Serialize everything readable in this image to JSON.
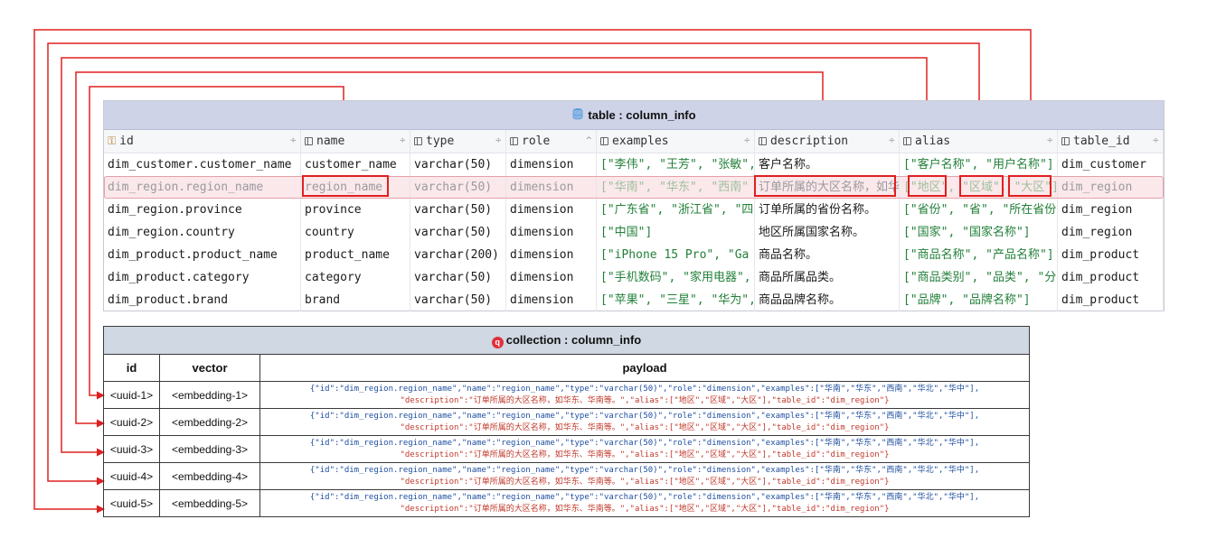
{
  "table": {
    "title": "table : column_info",
    "columns": [
      {
        "name": "id",
        "icon": "key-icon",
        "sort": "÷"
      },
      {
        "name": "name",
        "icon": "column-icon",
        "sort": "÷"
      },
      {
        "name": "type",
        "icon": "column-icon",
        "sort": "÷"
      },
      {
        "name": "role",
        "icon": "column-icon",
        "sort": "^"
      },
      {
        "name": "examples",
        "icon": "column-icon",
        "sort": "÷"
      },
      {
        "name": "description",
        "icon": "column-icon",
        "sort": "÷"
      },
      {
        "name": "alias",
        "icon": "column-icon",
        "sort": "÷"
      },
      {
        "name": "table_id",
        "icon": "column-icon",
        "sort": "÷"
      }
    ],
    "rows": [
      {
        "id": "dim_customer.customer_name",
        "name": "customer_name",
        "type": "varchar(50)",
        "role": "dimension",
        "examples": "[\"李伟\", \"王芳\", \"张敏\",",
        "description": "客户名称。",
        "alias": "[\"客户名称\", \"用户名称\"]",
        "table_id": "dim_customer"
      },
      {
        "id": "dim_region.region_name",
        "name": "region_name",
        "type": "varchar(50)",
        "role": "dimension",
        "examples": "[\"华南\", \"华东\", \"西南\"",
        "description": "订单所属的大区名称，如华",
        "alias": "[\"地区\", \"区域\", \"大区\"]",
        "table_id": "dim_region"
      },
      {
        "id": "dim_region.province",
        "name": "province",
        "type": "varchar(50)",
        "role": "dimension",
        "examples": "[\"广东省\", \"浙江省\", \"四",
        "description": "订单所属的省份名称。",
        "alias": "[\"省份\", \"省\", \"所在省份",
        "table_id": "dim_region"
      },
      {
        "id": "dim_region.country",
        "name": "country",
        "type": "varchar(50)",
        "role": "dimension",
        "examples": "[\"中国\"]",
        "description": "地区所属国家名称。",
        "alias": "[\"国家\", \"国家名称\"]",
        "table_id": "dim_region"
      },
      {
        "id": "dim_product.product_name",
        "name": "product_name",
        "type": "varchar(200)",
        "role": "dimension",
        "examples": "[\"iPhone 15 Pro\", \"Ga",
        "description": "商品名称。",
        "alias": "[\"商品名称\", \"产品名称\"]",
        "table_id": "dim_product"
      },
      {
        "id": "dim_product.category",
        "name": "category",
        "type": "varchar(50)",
        "role": "dimension",
        "examples": "[\"手机数码\", \"家用电器\",",
        "description": "商品所属品类。",
        "alias": "[\"商品类别\", \"品类\", \"分",
        "table_id": "dim_product"
      },
      {
        "id": "dim_product.brand",
        "name": "brand",
        "type": "varchar(50)",
        "role": "dimension",
        "examples": "[\"苹果\", \"三星\", \"华为\",",
        "description": "商品品牌名称。",
        "alias": "[\"品牌\", \"品牌名称\"]",
        "table_id": "dim_product"
      }
    ]
  },
  "collection": {
    "title": "collection : column_info",
    "headers": {
      "id": "id",
      "vector": "vector",
      "payload": "payload"
    },
    "rows": [
      {
        "id": "<uuid-1>",
        "vector": "<embedding-1>"
      },
      {
        "id": "<uuid-2>",
        "vector": "<embedding-2>"
      },
      {
        "id": "<uuid-3>",
        "vector": "<embedding-3>"
      },
      {
        "id": "<uuid-4>",
        "vector": "<embedding-4>"
      },
      {
        "id": "<uuid-5>",
        "vector": "<embedding-5>"
      }
    ],
    "payload_line1": "{\"id\":\"dim_region.region_name\",\"name\":\"region_name\",\"type\":\"varchar(50)\",\"role\":\"dimension\",\"examples\":[\"华南\",\"华东\",\"西南\",\"华北\",\"华中\"],",
    "payload_line2": "\"description\":\"订单所属的大区名称，如华东、华南等。\",\"alias\":[\"地区\",\"区域\",\"大区\"],\"table_id\":\"dim_region\"}"
  },
  "colors": {
    "arrow": "#e02020",
    "highlight_row": "#fbe8ea",
    "string_green": "#23803a",
    "payload_key": "#1f4fa0",
    "payload_value": "#c0392b"
  }
}
